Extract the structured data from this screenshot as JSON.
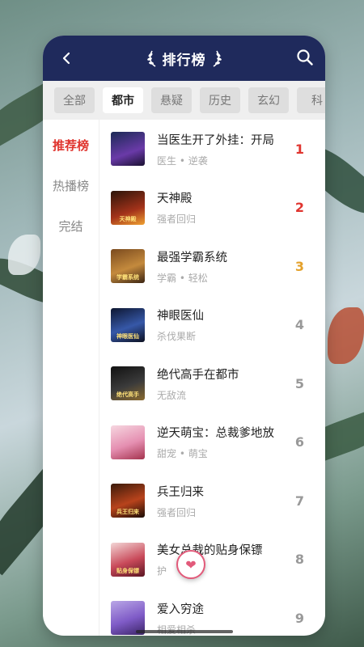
{
  "header": {
    "title": "排行榜"
  },
  "tabs": [
    {
      "label": "全部",
      "active": false
    },
    {
      "label": "都市",
      "active": true
    },
    {
      "label": "悬疑",
      "active": false
    },
    {
      "label": "历史",
      "active": false
    },
    {
      "label": "玄幻",
      "active": false
    },
    {
      "label": "科",
      "active": false
    }
  ],
  "sidebar": {
    "items": [
      {
        "label": "推荐榜",
        "active": true
      },
      {
        "label": "热播榜",
        "active": false
      },
      {
        "label": "完结",
        "active": false
      }
    ]
  },
  "books": [
    {
      "rank": "1",
      "title": "当医生开了外挂：开局",
      "tags": "医生 • 逆袭",
      "cover_text": ""
    },
    {
      "rank": "2",
      "title": "天神殿",
      "tags": "强者回归",
      "cover_text": "天神殿"
    },
    {
      "rank": "3",
      "title": "最强学霸系统",
      "tags": "学霸 • 轻松",
      "cover_text": "学霸系统"
    },
    {
      "rank": "4",
      "title": "神眼医仙",
      "tags": "杀伐果断",
      "cover_text": "神眼医仙"
    },
    {
      "rank": "5",
      "title": "绝代高手在都市",
      "tags": "无敌流",
      "cover_text": "绝代高手"
    },
    {
      "rank": "6",
      "title": "逆天萌宝：总裁爹地放",
      "tags": "甜宠 • 萌宝",
      "cover_text": ""
    },
    {
      "rank": "7",
      "title": "兵王归来",
      "tags": "强者回归",
      "cover_text": "兵王归来"
    },
    {
      "rank": "8",
      "title": "美女总裁的贴身保镖",
      "tags": "护",
      "cover_text": "贴身保镖"
    },
    {
      "rank": "9",
      "title": "爱入穷途",
      "tags": "相爱相杀",
      "cover_text": ""
    }
  ],
  "colors": {
    "header_bg": "#1f2a5c",
    "accent_red": "#e0352f",
    "accent_gold": "#e4a12b"
  }
}
